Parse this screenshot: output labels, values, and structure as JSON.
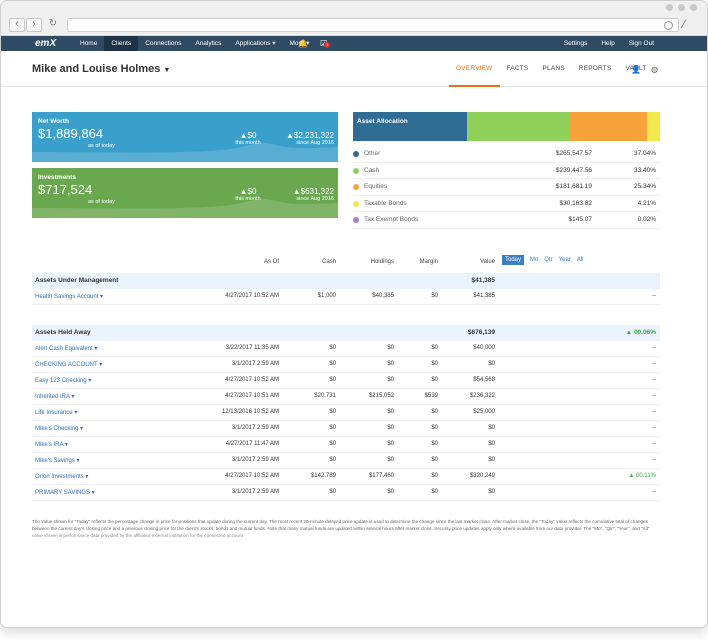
{
  "nav": {
    "logo": "emX",
    "items": [
      "Home",
      "Clients",
      "Connections",
      "Analytics",
      "Applications ▾",
      "More ▾"
    ],
    "active_index": 1,
    "notification_count": "1",
    "right_items": [
      "Settings",
      "Help",
      "Sign Out"
    ]
  },
  "client": {
    "name": "Mike and Louise Holmes",
    "tabs": [
      "OVERVIEW",
      "FACTS",
      "PLANS",
      "REPORTS",
      "VAULT"
    ],
    "active_tab": "OVERVIEW"
  },
  "net_worth": {
    "label": "Net Worth",
    "amount": "$1,889,864",
    "sub": "as of today",
    "month_change": "▲$0",
    "month_label": "this month",
    "since_change": "▲$2,231,322",
    "since_label": "since Aug 2016"
  },
  "investments": {
    "label": "Investments",
    "amount": "$717,524",
    "sub": "as of today",
    "month_change": "▲$0",
    "month_label": "this month",
    "since_change": "▲$631,322",
    "since_label": "since Aug 2016"
  },
  "allocation": {
    "title": "Asset Allocation",
    "items": [
      {
        "name": "Other",
        "value": "$265,547.57",
        "pct": "37.04%",
        "share": 37.04,
        "color": "#2e6c93"
      },
      {
        "name": "Cash",
        "value": "$239,447.56",
        "pct": "33.40%",
        "share": 33.4,
        "color": "#8fd15a"
      },
      {
        "name": "Equities",
        "value": "$181,681.19",
        "pct": "25.34%",
        "share": 25.34,
        "color": "#f6a33b"
      },
      {
        "name": "Taxable Bonds",
        "value": "$30,163.82",
        "pct": "4.21%",
        "share": 4.21,
        "color": "#f4e94c"
      },
      {
        "name": "Tax Exempt Bonds",
        "value": "$145.07",
        "pct": "0.02%",
        "share": 0.02,
        "color": "#a97cd6"
      }
    ]
  },
  "table": {
    "headers": {
      "asof": "As Of",
      "cash": "Cash",
      "holdings": "Holdings",
      "margin": "Margin",
      "value": "Value"
    },
    "periods": [
      "Today",
      "Mo",
      "Qtr",
      "Year",
      "All"
    ],
    "aum": {
      "label": "Assets Under Management",
      "total": "$41,385",
      "rows": [
        {
          "name": "Health Savings Account ▾",
          "asof": "4/27/2017 10:52 AM",
          "cash": "$1,000",
          "holdings": "$40,385",
          "margin": "$0",
          "value": "$41,385",
          "change": "--"
        }
      ]
    },
    "held_away": {
      "label": "Assets Held Away",
      "total": "$676,139",
      "change": "▲ 00.06%",
      "rows": [
        {
          "name": "Alert Cash Equivalent ▾",
          "asof": "3/22/2017 11:35 AM",
          "cash": "$0",
          "holdings": "$0",
          "margin": "$0",
          "value": "$40,000",
          "change": "--"
        },
        {
          "name": "CHECKING ACCOUNT ▾",
          "asof": "3/1/2017 2:59 AM",
          "cash": "$0",
          "holdings": "$0",
          "margin": "$0",
          "value": "$0",
          "change": "--"
        },
        {
          "name": "Easy 123 Checking ▾",
          "asof": "4/27/2017 10:52 AM",
          "cash": "$0",
          "holdings": "$0",
          "margin": "$0",
          "value": "$54,568",
          "change": "--"
        },
        {
          "name": "Inherited IRA ▾",
          "asof": "4/27/2017 10:51 AM",
          "cash": "$20,731",
          "holdings": "$215,052",
          "margin": "$539",
          "value": "$236,322",
          "change": "--"
        },
        {
          "name": "Life Insurance ▾",
          "asof": "12/13/2016 10:52 AM",
          "cash": "$0",
          "holdings": "$0",
          "margin": "$0",
          "value": "$25,000",
          "change": "--"
        },
        {
          "name": "Mike's Checking ▾",
          "asof": "3/1/2017 2:59 AM",
          "cash": "$0",
          "holdings": "$0",
          "margin": "$0",
          "value": "$0",
          "change": "--"
        },
        {
          "name": "Mike's IRA ▾",
          "asof": "4/27/2017 11:47 AM",
          "cash": "$0",
          "holdings": "$0",
          "margin": "$0",
          "value": "$0",
          "change": "--"
        },
        {
          "name": "Mike's Savings ▾",
          "asof": "3/1/2017 2:59 AM",
          "cash": "$0",
          "holdings": "$0",
          "margin": "$0",
          "value": "$0",
          "change": "--"
        },
        {
          "name": "Orion Investments ▾",
          "asof": "4/27/2017 10:52 AM",
          "cash": "$142,789",
          "holdings": "$177,460",
          "margin": "$0",
          "value": "$320,249",
          "change": "▲ 00.11%"
        },
        {
          "name": "PRIMARY SAVINGS ▾",
          "asof": "3/1/2017 2:59 AM",
          "cash": "$0",
          "holdings": "$0",
          "margin": "$0",
          "value": "$0",
          "change": "--"
        }
      ]
    }
  },
  "footnote": "The value shown for \"Today\" reflects the percentage change in price for positions that update during the current day. The most recent 20-minute delayed price update is used to determine the change since the last market close. After market close, the \"Today\" value reflects the cumulative total of changes between the current day's closing price and a previous closing price for the client's stocks, bonds and mutual funds. Note that many mutual funds are updated within several hours after market close. Security price updates apply only where available from our data provider. The \"Mo\", \"Qtr\", \"Year\", and \"All\" value shown is performance data provided by the affiliated external institution for the connected account."
}
